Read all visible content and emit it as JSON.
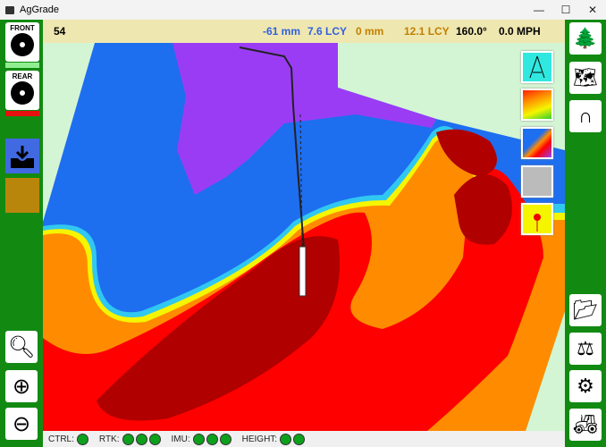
{
  "window": {
    "title": "AgGrade",
    "minimize": "—",
    "maximize": "☐",
    "close": "✕"
  },
  "left_sidebar": {
    "front_label": "FRONT",
    "rear_label": "REAR",
    "front_indicator_color": "#90ee90",
    "rear_indicator_color": "#e81010",
    "import_color": "#4169e1",
    "blank_color": "#b8860b"
  },
  "topbar": {
    "count": "54",
    "cut_depth": "-61 mm",
    "cut_volume": "7.6 LCY",
    "fill_depth": "0 mm",
    "fill_volume": "12.1 LCY",
    "heading": "160.0°",
    "speed": "0.0 MPH",
    "cut_color": "#3060e0",
    "fill_color": "#c08000"
  },
  "status": {
    "groups": [
      {
        "label": "CTRL:",
        "leds": 1
      },
      {
        "label": "RTK:",
        "leds": 3
      },
      {
        "label": "IMU:",
        "leds": 3
      },
      {
        "label": "HEIGHT:",
        "leds": 2
      }
    ]
  },
  "map_colors": {
    "background": "#d4f5d4",
    "purple": "#9b3cf5",
    "blue": "#1e6ef0",
    "cyan": "#30c8f0",
    "yellow": "#f5f500",
    "orange": "#ff8c00",
    "red": "#ff0000",
    "darkred": "#b00000"
  }
}
